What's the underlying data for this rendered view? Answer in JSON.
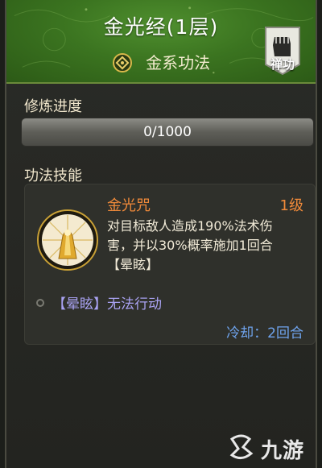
{
  "header": {
    "title": "金光经(1层)",
    "subtitle": "金系功法",
    "badge_label": "禅功",
    "subtitle_icon": "metal-element-icon",
    "badge_icon": "fist-icon"
  },
  "progress": {
    "section_label": "修炼进度",
    "text": "0/1000",
    "current": 0,
    "max": 1000
  },
  "skills": {
    "section_label": "功法技能",
    "items": [
      {
        "name": "金光咒",
        "level": "1级",
        "desc_line1": "对目标敌人造成190%法术伤",
        "desc_line2": "害，并以30%概率施加1回合",
        "desc_line3": "【晕眩】",
        "effect": "【晕眩】无法行动",
        "cooldown": "冷却：2回合",
        "icon": "golden-light-skill-icon"
      }
    ]
  },
  "watermark": {
    "text": "九游",
    "icon": "jiuyou-logo-icon"
  },
  "colors": {
    "header_green": "#3b7420",
    "skill_orange": "#f08a3a",
    "effect_purple": "#a9a2f2",
    "cooldown_blue": "#6fa4ee"
  }
}
